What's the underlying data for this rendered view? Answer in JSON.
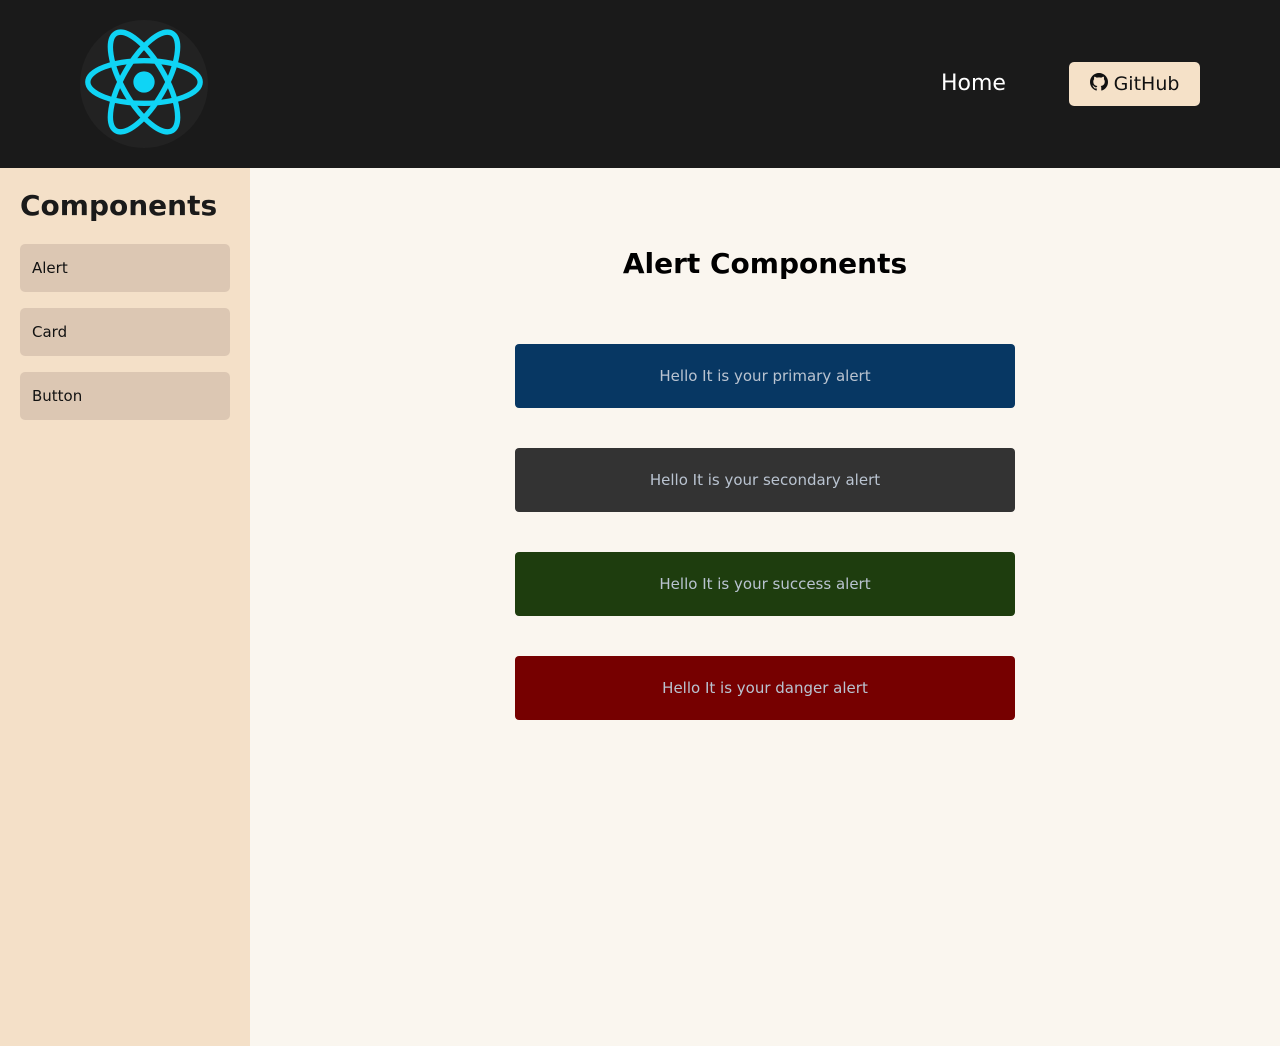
{
  "header": {
    "logo": {
      "icon": "react-atom-icon",
      "color": "#0fd4f5"
    },
    "nav": {
      "home_label": "Home"
    },
    "github": {
      "label": "GitHub",
      "icon": "github-icon"
    }
  },
  "sidebar": {
    "title": "Components",
    "items": [
      {
        "label": "Alert"
      },
      {
        "label": "Card"
      },
      {
        "label": "Button"
      }
    ]
  },
  "main": {
    "title": "Alert Components",
    "alerts": [
      {
        "text": "Hello It is your primary alert",
        "variant": "primary",
        "color": "#073763"
      },
      {
        "text": "Hello It is your secondary alert",
        "variant": "secondary",
        "color": "#333333"
      },
      {
        "text": "Hello It is your success alert",
        "variant": "success",
        "color": "#1e3d0e"
      },
      {
        "text": "Hello It is your danger alert",
        "variant": "danger",
        "color": "#760000"
      }
    ]
  },
  "colors": {
    "header_bg": "#1a1a1a",
    "sidebar_bg": "#f4e0c8",
    "sidebar_item_bg": "#dcc7b3",
    "main_bg": "#faf6ef",
    "github_button_bg": "#f5e1c8",
    "alert_text": "#b9c3d0"
  }
}
